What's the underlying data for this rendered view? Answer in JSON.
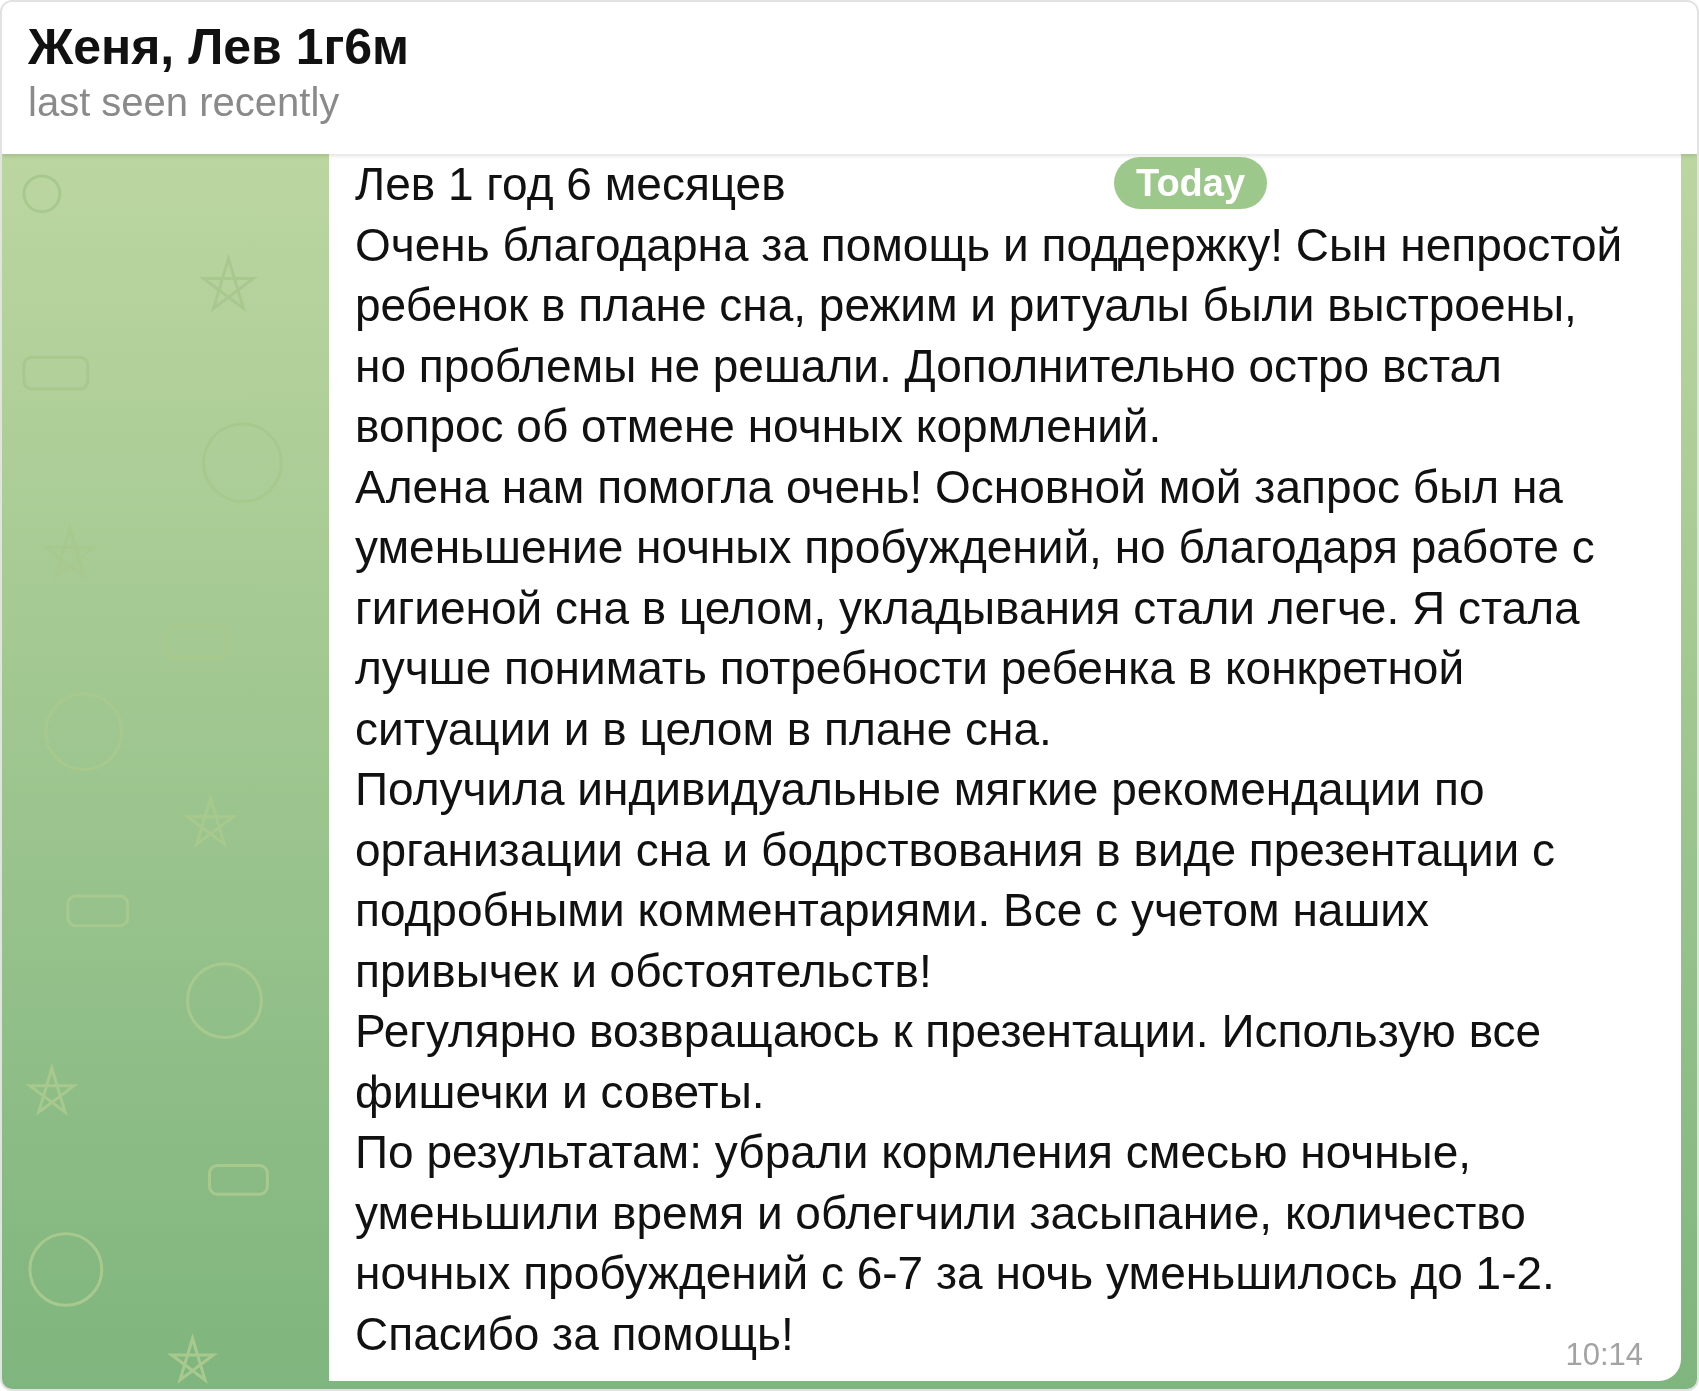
{
  "header": {
    "title": "Женя, Лев 1г6м",
    "status": "last seen recently"
  },
  "date_badge": "Today",
  "message": {
    "paragraphs": [
      {
        "lines": [
          "Лев 1 год 6 месяцев"
        ]
      },
      {
        "lines": [
          "Очень благодарна за помощь и поддержку! Сын непростой",
          "ребенок в плане сна, режим и ритуалы были выстроены,",
          "но проблемы не решали. Дополнительно остро встал",
          "вопрос об отмене ночных кормлений."
        ]
      },
      {
        "lines": [
          "Алена нам помогла очень! Основной мой запрос был на",
          "уменьшение ночных пробуждений, но благодаря работе с",
          "гигиеной сна в целом, укладывания стали легче. Я стала",
          "лучше понимать потребности ребенка в конкретной",
          "ситуации и в целом в плане сна."
        ]
      },
      {
        "lines": [
          "Получила индивидуальные мягкие рекомендации по",
          "организации сна и бодрствования в виде презентации с",
          "подробными комментариями. Все с учетом наших",
          "привычек и обстоятельств!"
        ]
      },
      {
        "lines": [
          "Регулярно возвращаюсь к презентации. Использую все",
          "фишечки и советы."
        ]
      },
      {
        "lines": [
          "По результатам: убрали кормления смесью ночные,",
          "уменьшили время и облегчили засыпание, количество",
          "ночных пробуждений с 6-7 за ночь уменьшилось до 1-2."
        ]
      },
      {
        "lines": [
          "Спасибо за помощь!"
        ]
      }
    ],
    "time": "10:14"
  }
}
